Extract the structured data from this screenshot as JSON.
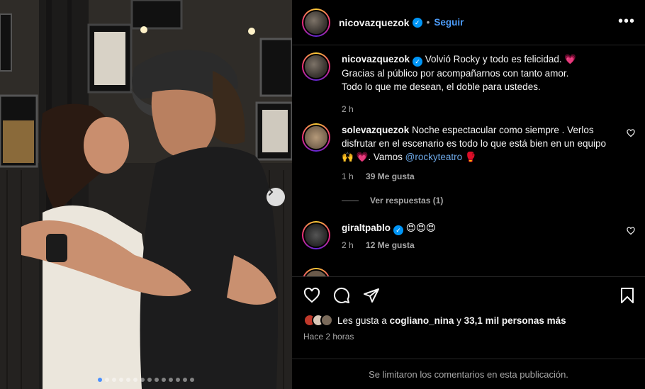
{
  "post": {
    "username": "nicovazquezok",
    "follow_label": "Seguir",
    "more_label": "•••"
  },
  "caption": {
    "username": "nicovazquezok",
    "text_line1": "Volvió Rocky y todo es felicidad. 💗",
    "text_line2": "Gracias al público por acompañarnos con tanto amor.",
    "text_line3": "Todo lo que me desean, el doble para ustedes.",
    "time": "2 h"
  },
  "comments": [
    {
      "username": "solevazquezok",
      "text_a": "Noche espectacular como siempre . Verlos disfrutar en el escenario es todo lo que está bien en un equipo 🙌 💗. Vamos ",
      "mention": "@rockyteatro",
      "text_b": " 🥊",
      "time": "1 h",
      "likes": "39 Me gusta",
      "replies_label": "Ver respuestas (1)"
    },
    {
      "username": "giraltpablo",
      "text": "😍😍😍",
      "time": "2 h",
      "likes": "12 Me gusta"
    }
  ],
  "likes_summary": {
    "prefix": "Les gusta a ",
    "user": "cogliano_nina",
    "suffix": " y ",
    "count": "33,1 mil personas más"
  },
  "posted_ago": "Hace 2 horas",
  "comments_limited": "Se limitaron los comentarios en esta publicación.",
  "carousel": {
    "total": 14,
    "active": 0
  },
  "colors": {
    "accent": "#0095f6",
    "link": "#4c9bf7",
    "bg": "#000000",
    "muted": "#a8a8a8"
  },
  "icons": [
    "heart-icon",
    "comment-icon",
    "share-icon",
    "bookmark-icon",
    "more-icon",
    "verified-icon",
    "chevron-right-icon"
  ]
}
